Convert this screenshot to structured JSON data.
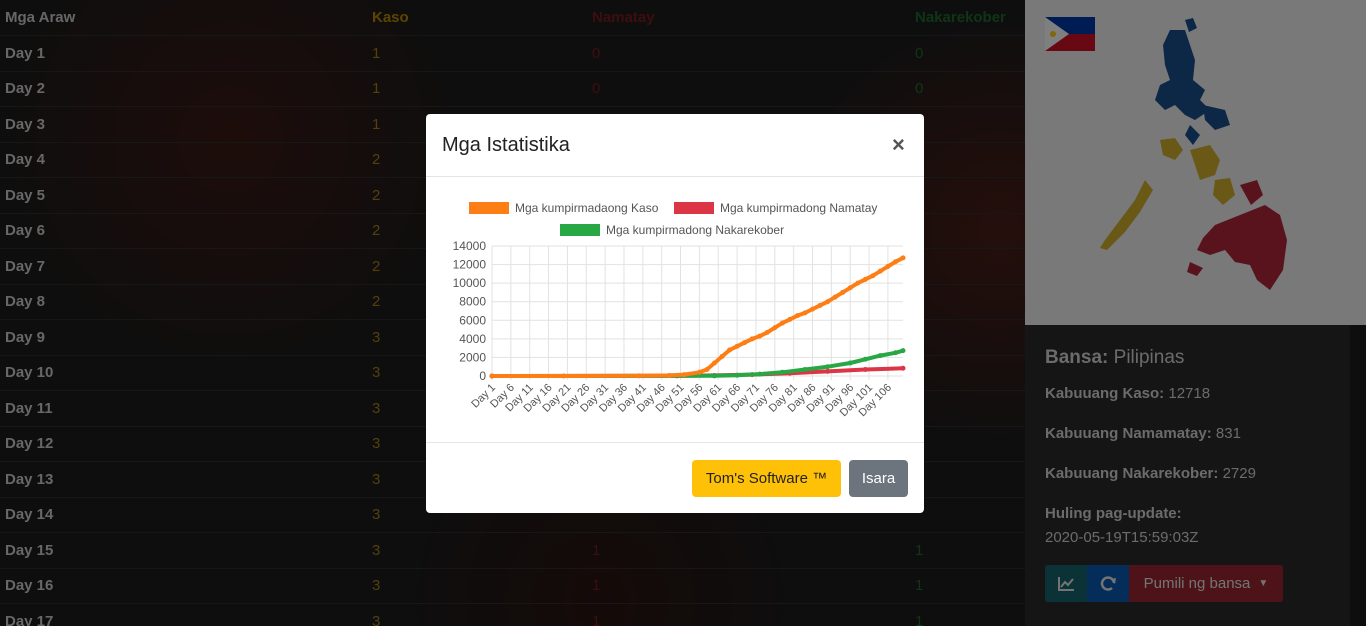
{
  "table": {
    "headers": [
      "Mga Araw",
      "Kaso",
      "Namatay",
      "Nakarekober"
    ],
    "rows": [
      {
        "day": "Day 1",
        "kaso": "1",
        "namatay": "0",
        "recov": "0"
      },
      {
        "day": "Day 2",
        "kaso": "1",
        "namatay": "0",
        "recov": "0"
      },
      {
        "day": "Day 3",
        "kaso": "1",
        "namatay": "",
        "recov": ""
      },
      {
        "day": "Day 4",
        "kaso": "2",
        "namatay": "",
        "recov": ""
      },
      {
        "day": "Day 5",
        "kaso": "2",
        "namatay": "",
        "recov": ""
      },
      {
        "day": "Day 6",
        "kaso": "2",
        "namatay": "",
        "recov": ""
      },
      {
        "day": "Day 7",
        "kaso": "2",
        "namatay": "",
        "recov": ""
      },
      {
        "day": "Day 8",
        "kaso": "2",
        "namatay": "",
        "recov": ""
      },
      {
        "day": "Day 9",
        "kaso": "3",
        "namatay": "",
        "recov": ""
      },
      {
        "day": "Day 10",
        "kaso": "3",
        "namatay": "",
        "recov": ""
      },
      {
        "day": "Day 11",
        "kaso": "3",
        "namatay": "",
        "recov": ""
      },
      {
        "day": "Day 12",
        "kaso": "3",
        "namatay": "",
        "recov": ""
      },
      {
        "day": "Day 13",
        "kaso": "3",
        "namatay": "",
        "recov": ""
      },
      {
        "day": "Day 14",
        "kaso": "3",
        "namatay": "",
        "recov": ""
      },
      {
        "day": "Day 15",
        "kaso": "3",
        "namatay": "1",
        "recov": "1"
      },
      {
        "day": "Day 16",
        "kaso": "3",
        "namatay": "1",
        "recov": "1"
      },
      {
        "day": "Day 17",
        "kaso": "3",
        "namatay": "1",
        "recov": "1"
      }
    ]
  },
  "info": {
    "country_label": "Bansa:",
    "country": "Pilipinas",
    "total_cases_label": "Kabuuang Kaso:",
    "total_cases": "12718",
    "total_deaths_label": "Kabuuang Namamatay:",
    "total_deaths": "831",
    "total_recovered_label": "Kabuuang Nakarekober:",
    "total_recovered": "2729",
    "last_update_label": "Huling pag-update:",
    "last_update": "2020-05-19T15:59:03Z",
    "chart_button_icon": "line-chart-icon",
    "refresh_button_icon": "refresh-icon",
    "select_country_label": "Pumili ng bansa"
  },
  "modal": {
    "title": "Mga Istatistika",
    "close_label": "×",
    "primary_button": "Tom's Software ™",
    "close_button": "Isara"
  },
  "colors": {
    "cases": "#fd7e14",
    "deaths": "#dc3545",
    "recovered": "#28a745",
    "teal_button": "#17a2b8",
    "blue_button": "#007bff",
    "red_button": "#dc3545",
    "yellow_button": "#ffc107",
    "gray_button": "#6c757d"
  },
  "chart_data": {
    "type": "line",
    "title": "",
    "xlabel": "",
    "ylabel": "",
    "ylim": [
      0,
      14000
    ],
    "y_ticks": [
      "0",
      "2000",
      "4000",
      "6000",
      "8000",
      "10000",
      "12000",
      "14000"
    ],
    "x_tick_labels": [
      "Day 1",
      "Day 6",
      "Day 11",
      "Day 16",
      "Day 21",
      "Day 26",
      "Day 31",
      "Day 36",
      "Day 41",
      "Day 46",
      "Day 51",
      "Day 56",
      "Day 61",
      "Day 66",
      "Day 71",
      "Day 76",
      "Day 81",
      "Day 86",
      "Day 91",
      "Day 96",
      "Day 101",
      "Day 106"
    ],
    "day_count": 110,
    "series": [
      {
        "name": "Mga kumpirmadaong Kaso",
        "days": [
          1,
          20,
          40,
          48,
          52,
          56,
          58,
          60,
          62,
          64,
          66,
          68,
          70,
          72,
          74,
          76,
          78,
          80,
          82,
          84,
          86,
          88,
          90,
          92,
          94,
          96,
          98,
          100,
          102,
          104,
          106,
          108,
          110
        ],
        "values": [
          1,
          3,
          20,
          60,
          150,
          400,
          700,
          1400,
          2100,
          2800,
          3200,
          3600,
          4000,
          4300,
          4700,
          5200,
          5700,
          6100,
          6500,
          6800,
          7200,
          7600,
          8000,
          8500,
          9000,
          9500,
          10000,
          10400,
          10800,
          11300,
          11800,
          12300,
          12718
        ]
      },
      {
        "name": "Mga kumpirmadong Namatay",
        "days": [
          1,
          50,
          60,
          70,
          80,
          90,
          100,
          110
        ],
        "values": [
          0,
          10,
          60,
          150,
          300,
          500,
          700,
          831
        ]
      },
      {
        "name": "Mga kumpirmadong Nakarekober",
        "days": [
          1,
          60,
          66,
          72,
          78,
          84,
          90,
          96,
          100,
          104,
          108,
          110
        ],
        "values": [
          0,
          20,
          80,
          200,
          400,
          700,
          1000,
          1400,
          1800,
          2200,
          2500,
          2729
        ]
      }
    ]
  }
}
